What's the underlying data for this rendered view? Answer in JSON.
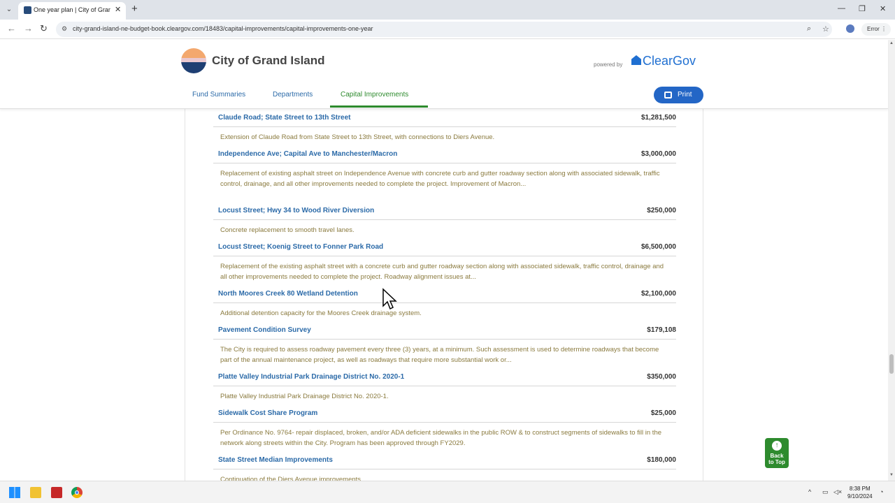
{
  "browser": {
    "tab_title": "One year plan | City of Grand Is",
    "tab_close": "✕",
    "new_tab": "+",
    "url": "city-grand-island-ne-budget-book.cleargov.com/18483/capital-improvements/capital-improvements-one-year",
    "error_label": "Error",
    "window_min": "—",
    "window_restore": "❐",
    "window_close": "✕"
  },
  "header": {
    "city_name": "City of Grand Island",
    "powered_by": "powered by",
    "brand": "ClearGov",
    "nav": [
      "Fund Summaries",
      "Departments",
      "Capital Improvements"
    ],
    "print_label": "Print"
  },
  "projects": [
    {
      "title": "Claude Road; State Street to 13th Street",
      "amount": "$1,281,500",
      "description": "Extension of Claude Road from State Street to 13th Street, with connections to Diers Avenue."
    },
    {
      "title": "Independence Ave; Capital Ave to Manchester/Macron",
      "amount": "$3,000,000",
      "description": "Replacement of existing asphalt street on Independence Avenue with concrete curb and gutter roadway section along with associated sidewalk, traffic control, drainage, and all other improvements needed to complete the project. Improvement of Macron..."
    },
    {
      "title": "Locust Street; Hwy 34 to Wood River Diversion",
      "amount": "$250,000",
      "description": "Concrete replacement to smooth travel lanes."
    },
    {
      "title": "Locust Street; Koenig Street to Fonner Park Road",
      "amount": "$6,500,000",
      "description": "Replacement of the existing asphalt street with a concrete curb and gutter roadway section along with associated sidewalk, traffic control, drainage and all other improvements needed to complete the project.  Roadway alignment issues at..."
    },
    {
      "title": "North Moores Creek 80 Wetland Detention",
      "amount": "$2,100,000",
      "description": "Additional detention capacity for the Moores Creek drainage system."
    },
    {
      "title": "Pavement Condition Survey",
      "amount": "$179,108",
      "description": "The City is required to assess roadway pavement every three (3) years, at a minimum.  Such assessment is used to determine roadways that become part of the annual maintenance project, as well as roadways that require more substantial work or..."
    },
    {
      "title": "Platte Valley Industrial Park Drainage District No. 2020-1",
      "amount": "$350,000",
      "description": "Platte Valley Industrial Park Drainage District No. 2020-1."
    },
    {
      "title": "Sidewalk Cost Share Program",
      "amount": "$25,000",
      "description": "Per Ordinance No. 9764- repair displaced, broken, and/or ADA deficient sidewalks in the public ROW & to construct segments of sidewalks to fill in the network along streets within the City.  Program has been approved through FY2029."
    },
    {
      "title": "State Street Median Improvements",
      "amount": "$180,000",
      "description": "Continuation of the Diers Avenue improvements..."
    }
  ],
  "back_to_top": {
    "line1": "Back",
    "line2": "to Top"
  },
  "taskbar": {
    "time": "8:38 PM",
    "date": "9/10/2024"
  },
  "colors": {
    "link": "#2b6aa8",
    "active": "#2e8b2e",
    "print_button": "#2366c6",
    "description": "#8a7a3e"
  }
}
